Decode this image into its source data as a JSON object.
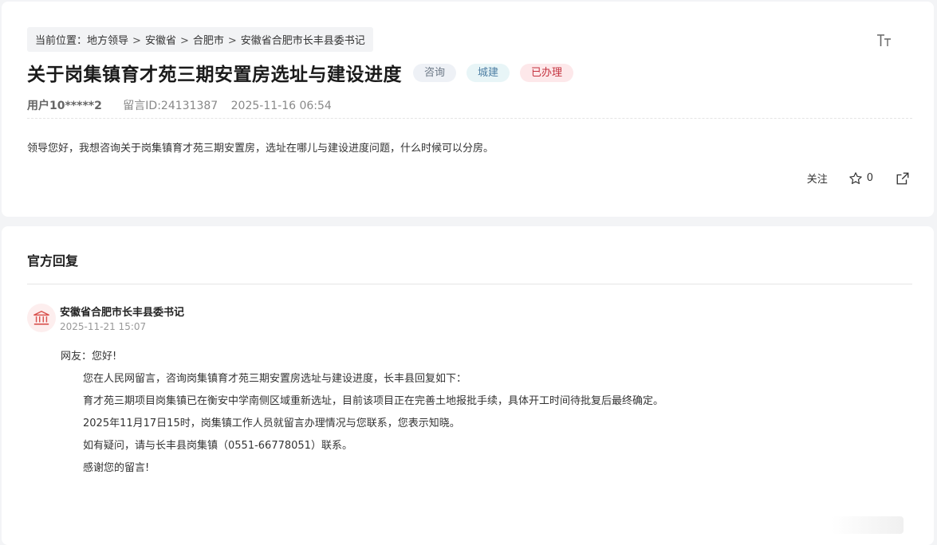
{
  "breadcrumb": {
    "prefix": "当前位置：",
    "items": [
      "地方领导",
      "安徽省",
      "合肥市",
      "安徽省合肥市长丰县委书记"
    ],
    "separator": ">"
  },
  "post": {
    "title": "关于岗集镇育才苑三期安置房选址与建设进度",
    "tags": [
      "咨询",
      "城建",
      "已办理"
    ],
    "user": "用户10*****2",
    "message_id": "留言ID:24131387",
    "datetime": "2025-11-16 06:54",
    "content": "领导您好，我想咨询关于岗集镇育才苑三期安置房，选址在哪儿与建设进度问题，什么时候可以分房。"
  },
  "actions": {
    "follow_label": "关注",
    "star_count": "0"
  },
  "reply": {
    "heading": "官方回复",
    "replier": "安徽省合肥市长丰县委书记",
    "time": "2025-11-21 15:07",
    "greeting": "网友：您好!",
    "paragraphs": [
      "您在人民网留言，咨询岗集镇育才苑三期安置房选址与建设进度，长丰县回复如下：",
      "育才苑三期项目岗集镇已在衡安中学南侧区域重新选址，目前该项目正在完善土地报批手续，具体开工时间待批复后最终确定。",
      "2025年11月17日15时，岗集镇工作人员就留言办理情况与您联系，您表示知晓。",
      "如有疑问，请与长丰县岗集镇（0551-66778051）联系。",
      "感谢您的留言!"
    ]
  },
  "icons": [
    "font-size-icon",
    "star-icon",
    "share-icon",
    "government-building-icon"
  ],
  "colors": {
    "tag_consult_bg": "#eef1f6",
    "tag_urban_bg": "#e8f5f7",
    "tag_done_bg": "#fde8ea",
    "tag_done_text": "#c4323f",
    "avatar_bg": "#fdeeee",
    "avatar_icon": "#d9534f"
  }
}
